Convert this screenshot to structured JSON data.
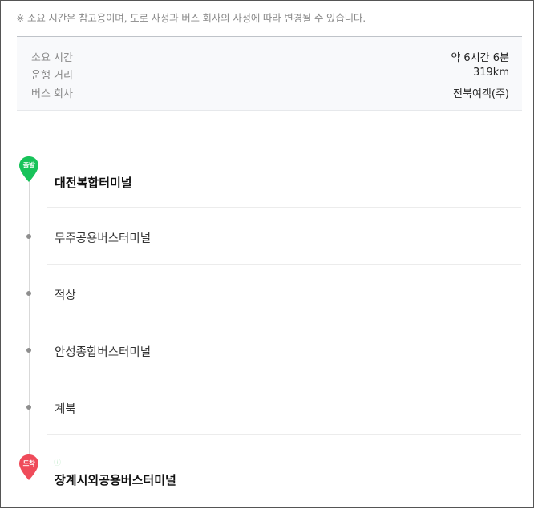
{
  "notice": "※ 소요 시간은 참고용이며, 도로 사정과 버스 회사의 사정에 따라 변경될 수 있습니다.",
  "info": [
    {
      "key": "소요 시간",
      "value": "약 6시간 6분"
    },
    {
      "key": "운행 거리",
      "value": "319km"
    },
    {
      "key": "버스 회사",
      "value": "전북여객(주)"
    }
  ],
  "route": {
    "departure_badge": "출발",
    "arrival_badge": "도착",
    "departure": "대전복합터미널",
    "stops": [
      "무주공용버스터미널",
      "적상",
      "안성종합버스터미널",
      "계북"
    ],
    "arrival": "장계시외공용버스터미널"
  },
  "colors": {
    "departure_pin": "#18c35a",
    "arrival_pin": "#ef4b5a"
  }
}
